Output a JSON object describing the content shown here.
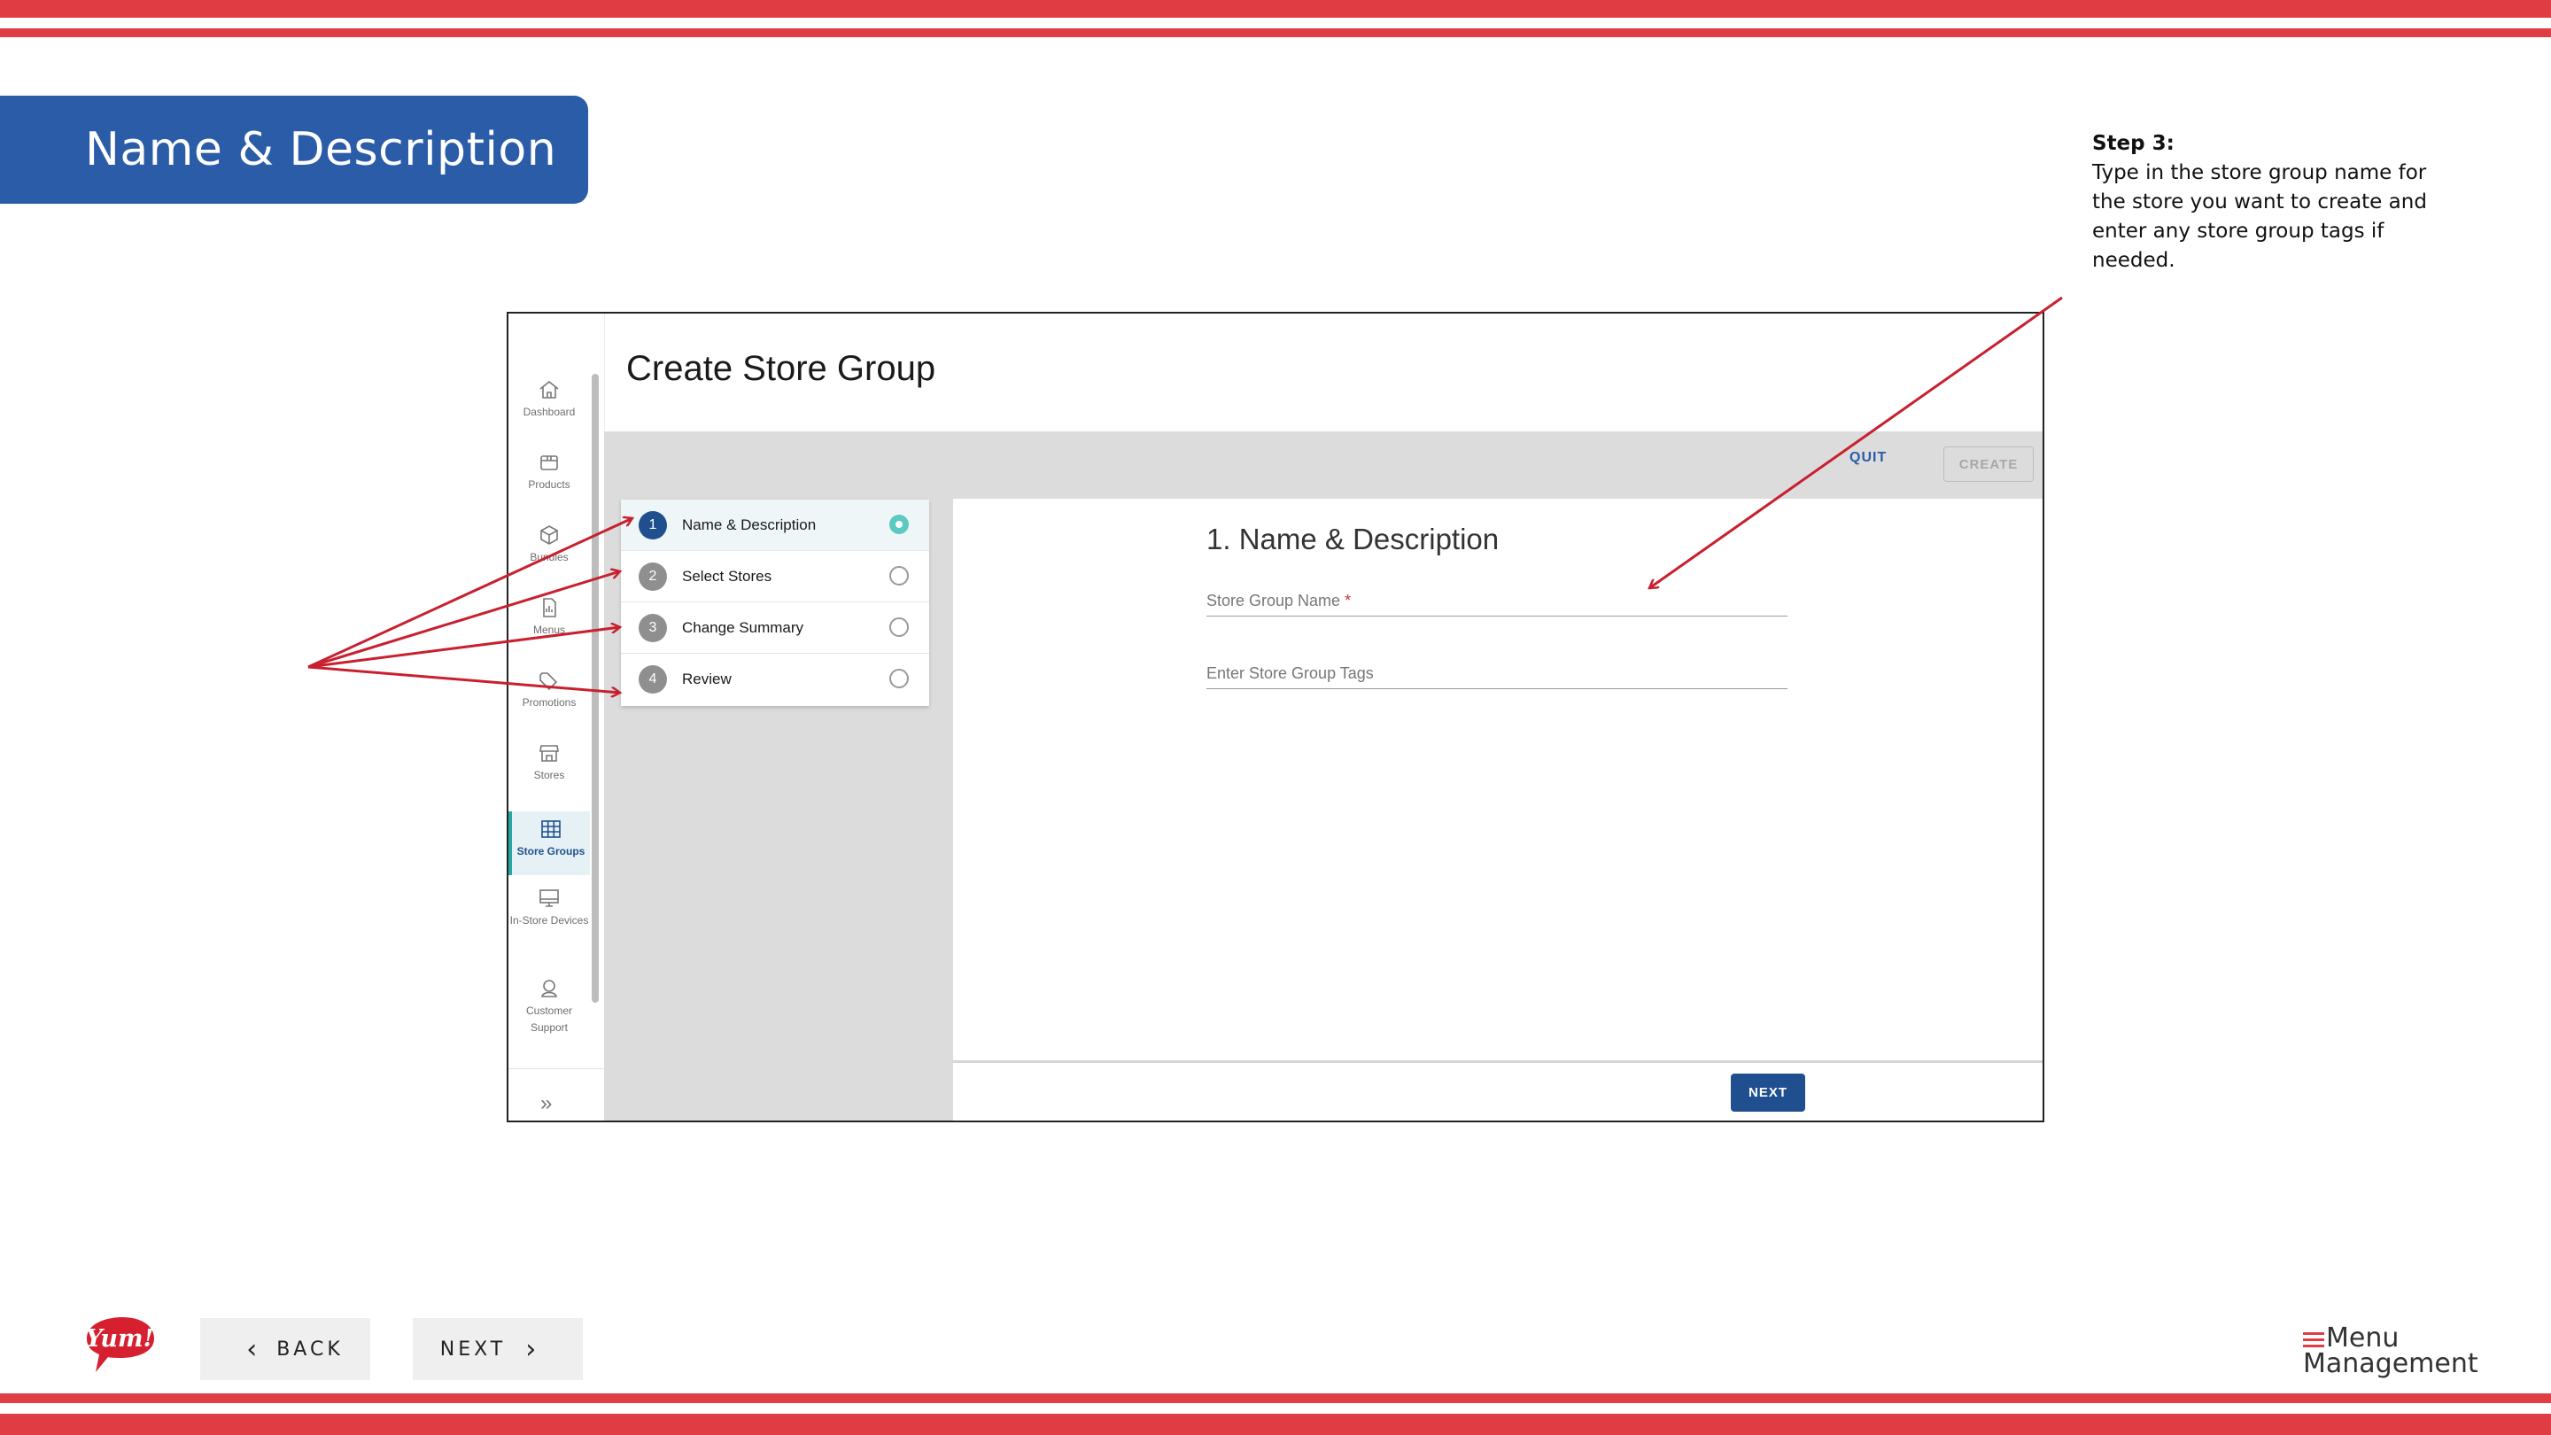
{
  "slide": {
    "title": "Name & Description",
    "step_heading": "Step 3:",
    "step_body": "Type in the store group name for the store you want to create and enter any store group tags if needed.",
    "back_label": "BACK",
    "next_label": "NEXT",
    "brand_left": "Yum!",
    "brand_right_line1": "Menu",
    "brand_right_line2": "Management",
    "stripe_color": "#e03c44",
    "title_bar_color": "#2a5ca8"
  },
  "app": {
    "page_title": "Create Store Group",
    "quit_label": "QUIT",
    "create_label": "CREATE",
    "nav": [
      {
        "label": "Dashboard",
        "icon": "home-icon"
      },
      {
        "label": "Products",
        "icon": "box-icon"
      },
      {
        "label": "Bundles",
        "icon": "cube-icon"
      },
      {
        "label": "Menus",
        "icon": "document-icon"
      },
      {
        "label": "Promotions",
        "icon": "tag-icon"
      },
      {
        "label": "Stores",
        "icon": "storefront-icon"
      },
      {
        "label": "Store Groups",
        "icon": "grid-icon",
        "active": true
      },
      {
        "label": "In-Store Devices",
        "icon": "monitor-icon"
      },
      {
        "label": "Customer Support",
        "icon": "headset-icon"
      }
    ],
    "steps": [
      {
        "num": "1",
        "label": "Name & Description",
        "active": true
      },
      {
        "num": "2",
        "label": "Select Stores"
      },
      {
        "num": "3",
        "label": "Change Summary"
      },
      {
        "num": "4",
        "label": "Review"
      }
    ],
    "form": {
      "title": "1. Name & Description",
      "name_placeholder": "Store Group Name",
      "required_marker": "*",
      "tags_placeholder": "Enter Store Group Tags"
    },
    "next_label": "NEXT",
    "accent_color": "#1f4f8f",
    "radio_active_color": "#5cc9c3"
  }
}
